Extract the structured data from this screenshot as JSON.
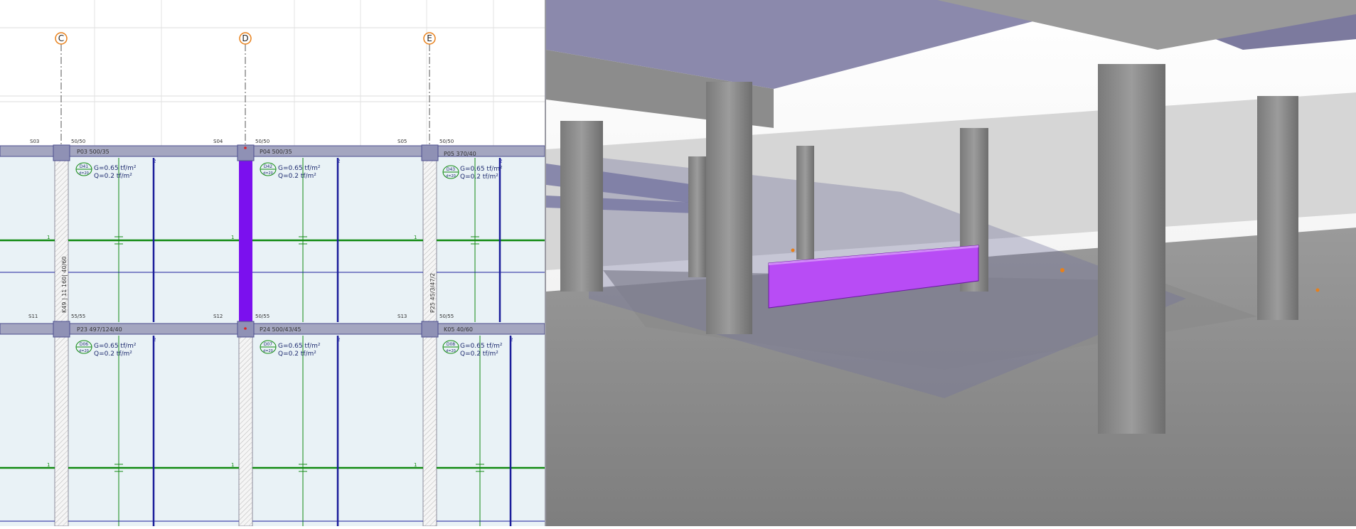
{
  "plan": {
    "axes": [
      {
        "label": "C"
      },
      {
        "label": "D"
      },
      {
        "label": "E"
      }
    ],
    "columns_top": [
      {
        "name": "S03"
      },
      {
        "name": "S04"
      },
      {
        "name": "S05"
      }
    ],
    "column_sizes_top": [
      "50/50",
      "50/50",
      "50/50"
    ],
    "columns_mid": [
      {
        "name": "S11"
      },
      {
        "name": "S12"
      },
      {
        "name": "S13"
      }
    ],
    "column_sizes_mid": [
      "55/55",
      "50/55",
      "50/55"
    ],
    "beams_top": [
      "P03  500/35",
      "P04  500/35",
      "P05  370/40"
    ],
    "beams_mid": [
      "P23  497/124/40",
      "P24  500/43/45",
      "K05  40/60"
    ],
    "vertical_beams": [
      "K49 | 11 160|  40/60",
      "P25  45/3/47/2"
    ],
    "slabs_upper": [
      {
        "id": "D41",
        "thk": "d=20",
        "g": "G=0.65 tf/m²",
        "q": "Q=0.2 tf/m²"
      },
      {
        "id": "D42",
        "thk": "d=20",
        "g": "G=0.65 tf/m²",
        "q": "Q=0.2 tf/m²"
      },
      {
        "id": "D43",
        "thk": "d=20",
        "g": "G=0.65 tf/m²",
        "q": "Q=0.2 tf/m²"
      }
    ],
    "slabs_lower": [
      {
        "id": "D06",
        "thk": "d=20",
        "g": "G=0.65 tf/m²",
        "q": "Q=0.2 tf/m²"
      },
      {
        "id": "D07",
        "thk": "d=20",
        "g": "G=0.65 tf/m²",
        "q": "Q=0.2 tf/m²"
      },
      {
        "id": "D08",
        "thk": "d=20",
        "g": "G=0.65 tf/m²",
        "q": "Q=0.2 tf/m²"
      }
    ],
    "rebar_marks": [
      "1",
      "2"
    ]
  },
  "colors": {
    "plan_background": "#ffffff",
    "slab_fill": "#e9f2f6",
    "beam_fill": "#a4a6c0",
    "beam_edge": "#4d4f8f",
    "selected_beam": "#7b10ee",
    "rebar_green": "#118a11",
    "rebar_blue": "#1a1d9a",
    "axis_bubble": "#e8801a",
    "selected_3d_beam": "#b84cf5",
    "concrete": "#8c8c8c",
    "glass_slab": "#6f6f9c"
  }
}
